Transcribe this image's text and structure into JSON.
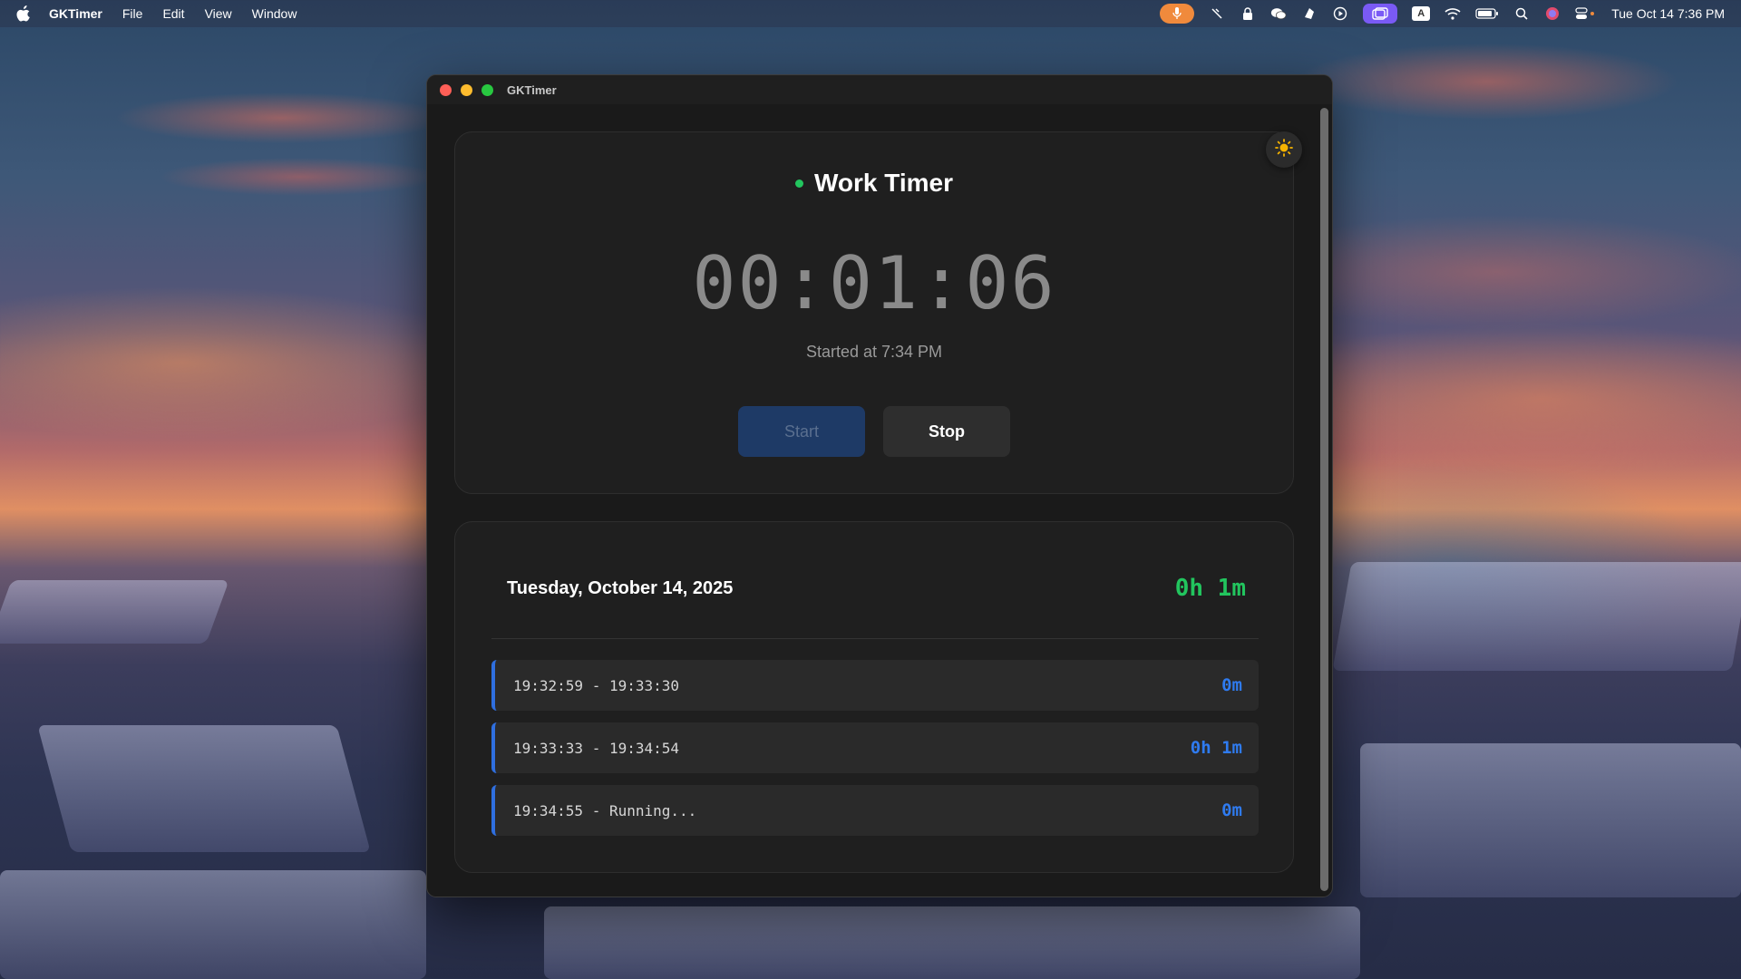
{
  "menubar": {
    "app_name": "GKTimer",
    "menus": [
      "File",
      "Edit",
      "View",
      "Window"
    ],
    "status_icons": [
      "mic-icon",
      "tool-icon",
      "lock-icon",
      "wechat-icon",
      "cloud-icon",
      "play-icon",
      "screen-icon",
      "keyboard-input-icon",
      "wifi-icon",
      "battery-icon",
      "search-icon",
      "siri-icon",
      "control-center-icon"
    ],
    "input_source": "A",
    "datetime": "Tue Oct 14  7:36 PM",
    "accent_orange": "#f08a3c",
    "accent_purple": "#7a5af5"
  },
  "window": {
    "title": "GKTimer"
  },
  "timer": {
    "title": "Work Timer",
    "elapsed": "00:01:06",
    "started_text": "Started at 7:34 PM",
    "start_label": "Start",
    "stop_label": "Stop",
    "status_color": "#22c55e"
  },
  "log": {
    "date": "Tuesday, October 14, 2025",
    "total": "0h 1m",
    "sessions": [
      {
        "range": "19:32:59 - 19:33:30",
        "duration": "0m"
      },
      {
        "range": "19:33:33 - 19:34:54",
        "duration": "0h 1m"
      },
      {
        "range": "19:34:55 - Running...",
        "duration": "0m"
      }
    ],
    "accent_blue": "#2f6fe0"
  }
}
